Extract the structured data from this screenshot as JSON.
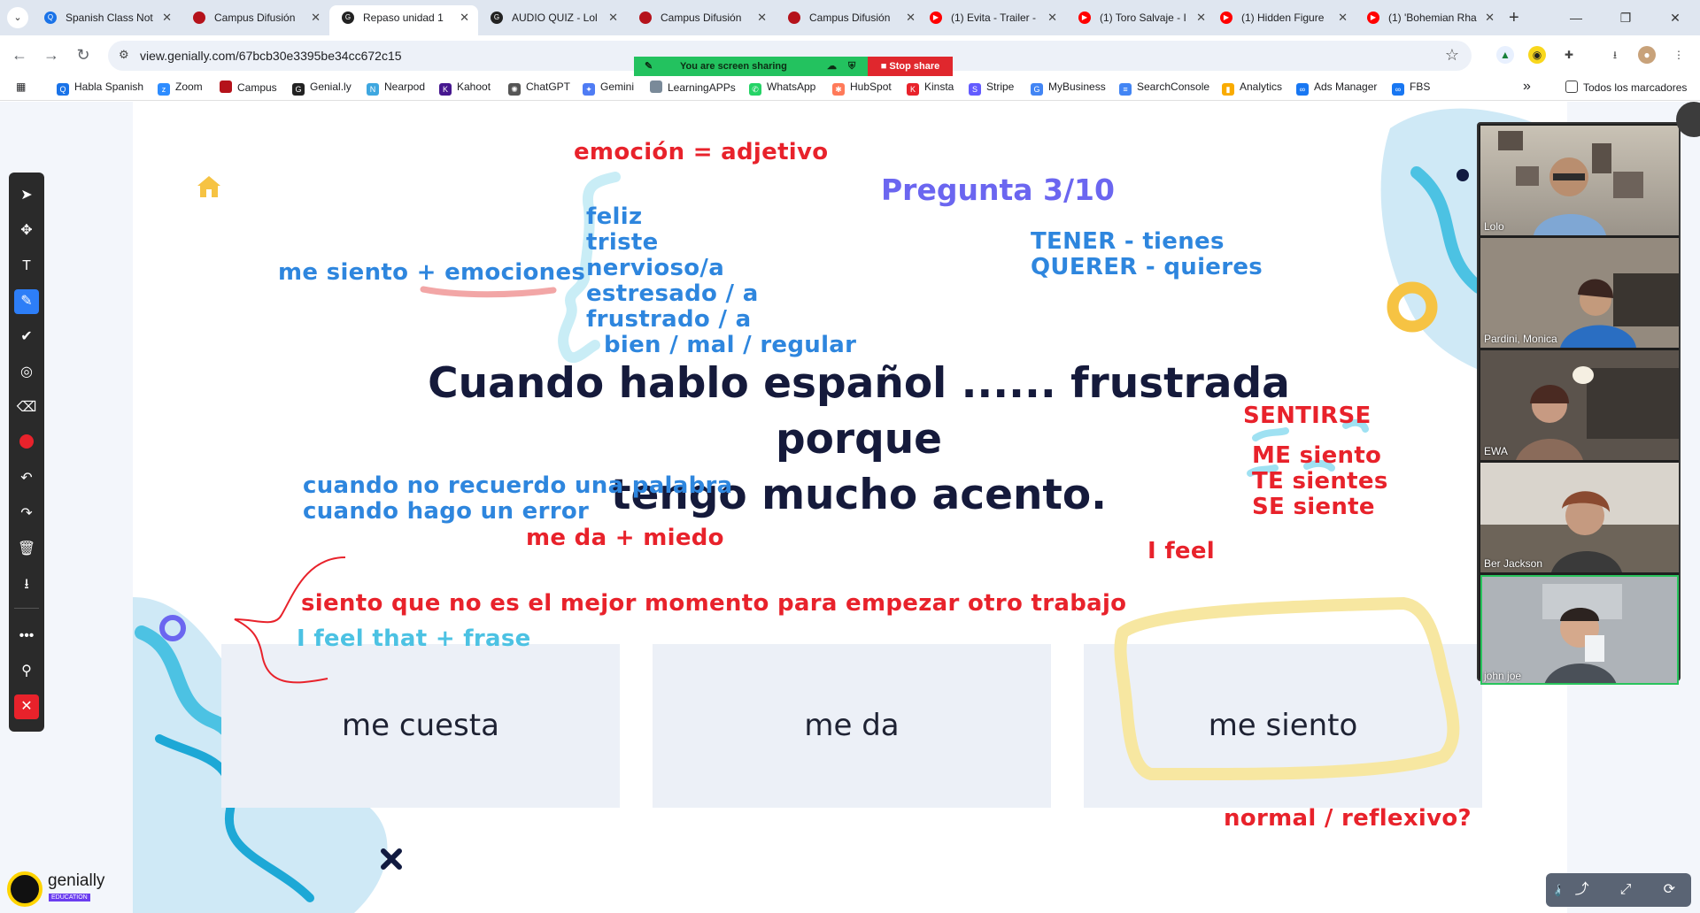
{
  "browser": {
    "tabs": [
      {
        "title": "Spanish Class Not",
        "favicon": "search-icon",
        "color": "#1a73e8"
      },
      {
        "title": "Campus Difusión",
        "favicon": "difusion-icon",
        "color": "#b5121b"
      },
      {
        "title": "Repaso unidad 1",
        "favicon": "genially-icon",
        "color": "#222222",
        "active": true
      },
      {
        "title": "AUDIO QUIZ - Lol",
        "favicon": "genially-icon",
        "color": "#222222"
      },
      {
        "title": "Campus Difusión",
        "favicon": "difusion-icon",
        "color": "#b5121b"
      },
      {
        "title": "Campus Difusión",
        "favicon": "difusion-icon",
        "color": "#b5121b"
      },
      {
        "title": "(1) Evita - Trailer -",
        "favicon": "youtube-icon",
        "color": "#ff0000"
      },
      {
        "title": "(1) Toro Salvaje - I",
        "favicon": "youtube-icon",
        "color": "#ff0000"
      },
      {
        "title": "(1) Hidden Figure",
        "favicon": "youtube-icon",
        "color": "#ff0000"
      },
      {
        "title": "(1) 'Bohemian Rha",
        "favicon": "youtube-icon",
        "color": "#ff0000"
      }
    ],
    "url": "view.genially.com/67bcb30e3395be34cc672c15",
    "share_banner": {
      "status": "You are screen sharing",
      "stop": "Stop share"
    },
    "bookmarks": [
      {
        "label": "Habla Spanish",
        "color": "#1a73e8"
      },
      {
        "label": "Zoom",
        "color": "#2d8cff"
      },
      {
        "label": "Campus",
        "color": "#b5121b"
      },
      {
        "label": "Genial.ly",
        "color": "#222222"
      },
      {
        "label": "Nearpod",
        "color": "#3ea7e0"
      },
      {
        "label": "Kahoot",
        "color": "#46178f"
      },
      {
        "label": "ChatGPT",
        "color": "#555555"
      },
      {
        "label": "Gemini",
        "color": "#4f7cf4"
      },
      {
        "label": "LearningAPPs",
        "color": "#7a8a99"
      },
      {
        "label": "WhatsApp",
        "color": "#25d366"
      },
      {
        "label": "HubSpot",
        "color": "#ff7a59"
      },
      {
        "label": "Kinsta",
        "color": "#e8222b"
      },
      {
        "label": "Stripe",
        "color": "#635bff"
      },
      {
        "label": "MyBusiness",
        "color": "#4285f4"
      },
      {
        "label": "SearchConsole",
        "color": "#4285f4"
      },
      {
        "label": "Analytics",
        "color": "#f9ab00"
      },
      {
        "label": "Ads Manager",
        "color": "#1877f2"
      },
      {
        "label": "FBS",
        "color": "#1877f2"
      }
    ],
    "all_bookmarks": "Todos los marcadores",
    "more_bookmarks": "»"
  },
  "slide": {
    "pregunta": "Pregunta 3/10",
    "sentence_line1": "Cuando hablo español ...... frustrada porque",
    "sentence_line2": "tengo mucho acento.",
    "answers": [
      "me cuesta",
      "me da",
      "me siento"
    ],
    "annotations": {
      "emocion_adjetivo": "emoción = adjetivo",
      "me_siento_plus": "me siento + ",
      "emociones": "emociones",
      "adjectives": [
        "feliz",
        "triste",
        "nervioso/a",
        "estresado / a",
        "frustrado / a"
      ],
      "bien_mal_regular": "bien / mal / regular",
      "tener": "TENER - tienes",
      "querer": "QUERER - quieres",
      "sentirse": "SENTIRSE",
      "me_siento": "ME siento",
      "te_sientes": "TE sientes",
      "se_siente": "SE siente",
      "i_feel": "I feel",
      "cuando1": "cuando no recuerdo una palabra",
      "cuando2": "cuando hago un error",
      "me_da_miedo": "me da + miedo",
      "siento_que": "siento que no es el mejor momento para empezar otro trabajo",
      "i_feel_that": "I feel that + frase",
      "normal_reflexivo": "normal / reflexivo?"
    },
    "brand": {
      "name": "genially",
      "edition": "EDUCATION"
    }
  },
  "participants": [
    {
      "name": "Lolo"
    },
    {
      "name": "Pardini, Monica"
    },
    {
      "name": "EWA"
    },
    {
      "name": "Ber Jackson"
    },
    {
      "name": "john joe",
      "speaking": true
    }
  ],
  "colors": {
    "annotation_red": "#e8222b",
    "annotation_blue": "#2e86de",
    "annotation_cyan": "#4cc2e3",
    "pregunta": "#6b66f0",
    "sentence": "#151a3b",
    "highlight_yellow": "#f7e7a1"
  }
}
